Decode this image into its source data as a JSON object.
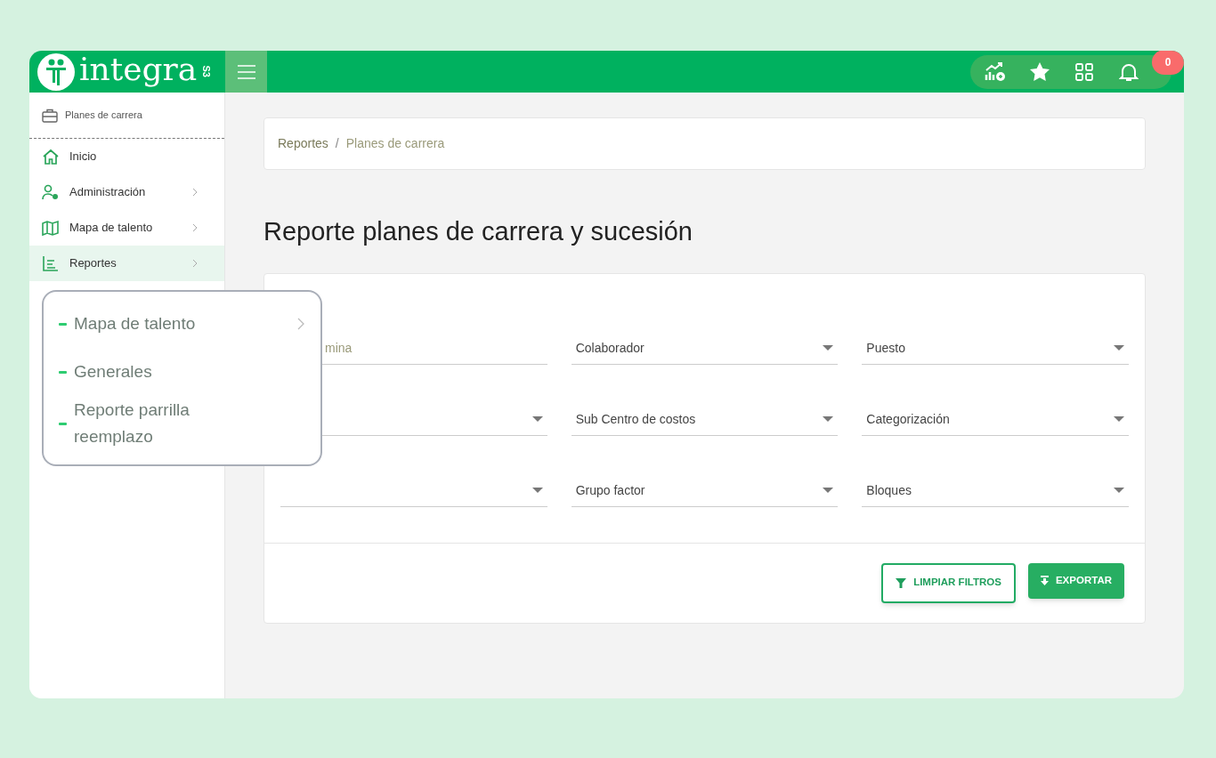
{
  "logo": {
    "wordmark": "integra",
    "badge": "S3"
  },
  "header": {
    "notifications": "0"
  },
  "sidebar": {
    "module": "Planes de carrera",
    "items": [
      {
        "label": "Inicio",
        "has_submenu": false,
        "selected": false
      },
      {
        "label": "Administración",
        "has_submenu": true,
        "selected": false
      },
      {
        "label": "Mapa de talento",
        "has_submenu": true,
        "selected": false
      },
      {
        "label": "Reportes",
        "has_submenu": true,
        "selected": true
      }
    ]
  },
  "submenu": [
    {
      "label": "Mapa de talento",
      "has_submenu": true
    },
    {
      "label": "Generales",
      "has_submenu": false
    },
    {
      "label": "Reporte parrilla reemplazo",
      "has_submenu": false
    }
  ],
  "breadcrumb": {
    "items": [
      "Reportes",
      "Planes de carrera"
    ],
    "separator": "/"
  },
  "title": "Reporte planes de carrera y sucesión",
  "filters": [
    {
      "kind": "text",
      "placeholder": "mina"
    },
    {
      "kind": "select",
      "label": "Colaborador"
    },
    {
      "kind": "select",
      "label": "Puesto"
    },
    {
      "kind": "select"
    },
    {
      "kind": "select",
      "label": "Sub Centro de costos"
    },
    {
      "kind": "select",
      "label": "Categorización"
    },
    {
      "kind": "select"
    },
    {
      "kind": "select",
      "label": "Grupo factor"
    },
    {
      "kind": "select",
      "label": "Bloques"
    }
  ],
  "buttons": [
    {
      "kind": "outline",
      "label": "LIMPIAR FILTROS"
    },
    {
      "kind": "solid",
      "label": "EXPORTAR"
    }
  ]
}
